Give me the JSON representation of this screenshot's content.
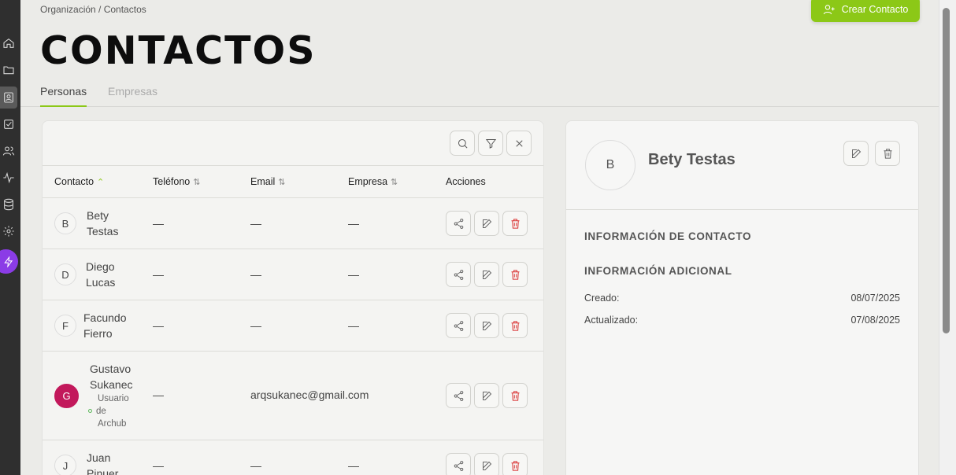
{
  "breadcrumb": "Organización / Contactos",
  "header": {
    "title": "CONTACTOS",
    "create_label": "Crear Contacto"
  },
  "tabs": [
    {
      "label": "Personas"
    },
    {
      "label": "Empresas"
    }
  ],
  "table": {
    "columns": {
      "contact": "Contacto",
      "phone": "Teléfono",
      "email": "Email",
      "company": "Empresa",
      "actions": "Acciones"
    },
    "rows": [
      {
        "initial": "B",
        "first": "Bety",
        "last": "Testas",
        "phone": "—",
        "email": "—",
        "company": "—"
      },
      {
        "initial": "D",
        "first": "Diego",
        "last": "Lucas",
        "phone": "—",
        "email": "—",
        "company": "—"
      },
      {
        "initial": "F",
        "first": "Facundo",
        "last": "Fierro",
        "phone": "—",
        "email": "—",
        "company": "—"
      },
      {
        "initial": "G",
        "first": "Gustavo",
        "last": "Sukanec",
        "phone": "—",
        "email": "arqsukanec@gmail.com",
        "company": "",
        "sub1": "Usuario",
        "sub2": "de",
        "sub3": "Archub"
      },
      {
        "initial": "J",
        "first": "Juan",
        "last": "Pinuer",
        "phone": "—",
        "email": "—",
        "company": "—"
      }
    ]
  },
  "detail": {
    "initial": "B",
    "name": "Bety Testas",
    "section_contact": "INFORMACIÓN DE CONTACTO",
    "section_additional": "INFORMACIÓN ADICIONAL",
    "created_label": "Creado:",
    "created_value": "08/07/2025",
    "updated_label": "Actualizado:",
    "updated_value": "07/08/2025"
  },
  "colors": {
    "accent": "#8cc817",
    "sidebar": "#2f2f2f",
    "danger": "#d93030",
    "avatar_filled": "#c2185b",
    "bolt": "#8b3ce6"
  },
  "icons": [
    "home-icon",
    "folder-icon",
    "contacts-icon",
    "tasks-icon",
    "users-icon",
    "activity-icon",
    "database-icon",
    "settings-icon",
    "bolt-icon",
    "user-plus-icon",
    "search-icon",
    "filter-icon",
    "close-icon",
    "share-icon",
    "edit-icon",
    "trash-icon"
  ]
}
